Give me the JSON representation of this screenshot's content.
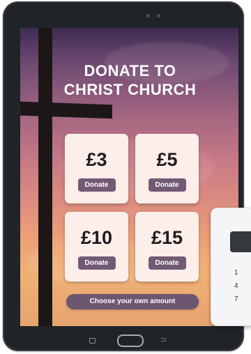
{
  "app": {
    "title_line1": "DONATE TO",
    "title_line2": "CHRIST CHURCH"
  },
  "donation_options": [
    {
      "amount": "£3",
      "button_label": "Donate"
    },
    {
      "amount": "£5",
      "button_label": "Donate"
    },
    {
      "amount": "£10",
      "button_label": "Donate"
    },
    {
      "amount": "£15",
      "button_label": "Donate"
    }
  ],
  "custom_amount_label": "Choose your own amount",
  "card_reader": {
    "keys": [
      "1",
      "4",
      "7"
    ]
  },
  "colors": {
    "button": "#735a74",
    "card": "#fcefea",
    "tablet_bezel": "#202328"
  },
  "icons": {
    "nav_recent": "recent-apps-icon",
    "nav_home": "home-icon",
    "nav_back": "back-icon"
  }
}
